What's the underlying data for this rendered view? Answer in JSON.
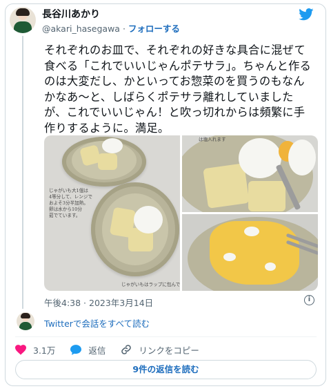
{
  "author": {
    "name": "長谷川あかり",
    "handle": "@akari_hasegawa",
    "separator": "·",
    "follow_label": "フォローする"
  },
  "tweet": {
    "text": "それぞれのお皿で、それぞれの好きな具合に混ぜて食べる「これでいいじゃんポテサラ」。ちゃんと作るのは大変だし、かといってお惣菜のを買うのもなんかなあ〜と、しばらくポテサラ離れしていましたが、これでいいじゃん！と吹っ切れからは頻繁に手作りするように。満足。",
    "photo_note_1": "じゃがいも大1個は\n4等分して、レンジで\nおよそ3分半加熱。\n卵は水から10分\n茹でています。",
    "photo_note_2": "じゃがいもはラップに包んで",
    "photo_note_3": "は塩入れます",
    "timestamp": "午後4:38 · 2023年3月14日"
  },
  "links": {
    "read_conversation": "Twitterで会話をすべて読む"
  },
  "actions": {
    "likes": "3.1万",
    "reply_label": "返信",
    "copy_link_label": "リンクをコピー"
  },
  "replies_button": "9件の返信を読む",
  "icons": {
    "brand": "twitter-bird-icon",
    "info": "info-icon",
    "like": "heart-icon",
    "reply": "speech-bubble-icon",
    "link": "link-icon"
  },
  "colors": {
    "brand": "#1d9bf0",
    "link": "#1d6dbd",
    "like": "#f91880",
    "text": "#0f1419",
    "muted": "#536471"
  }
}
